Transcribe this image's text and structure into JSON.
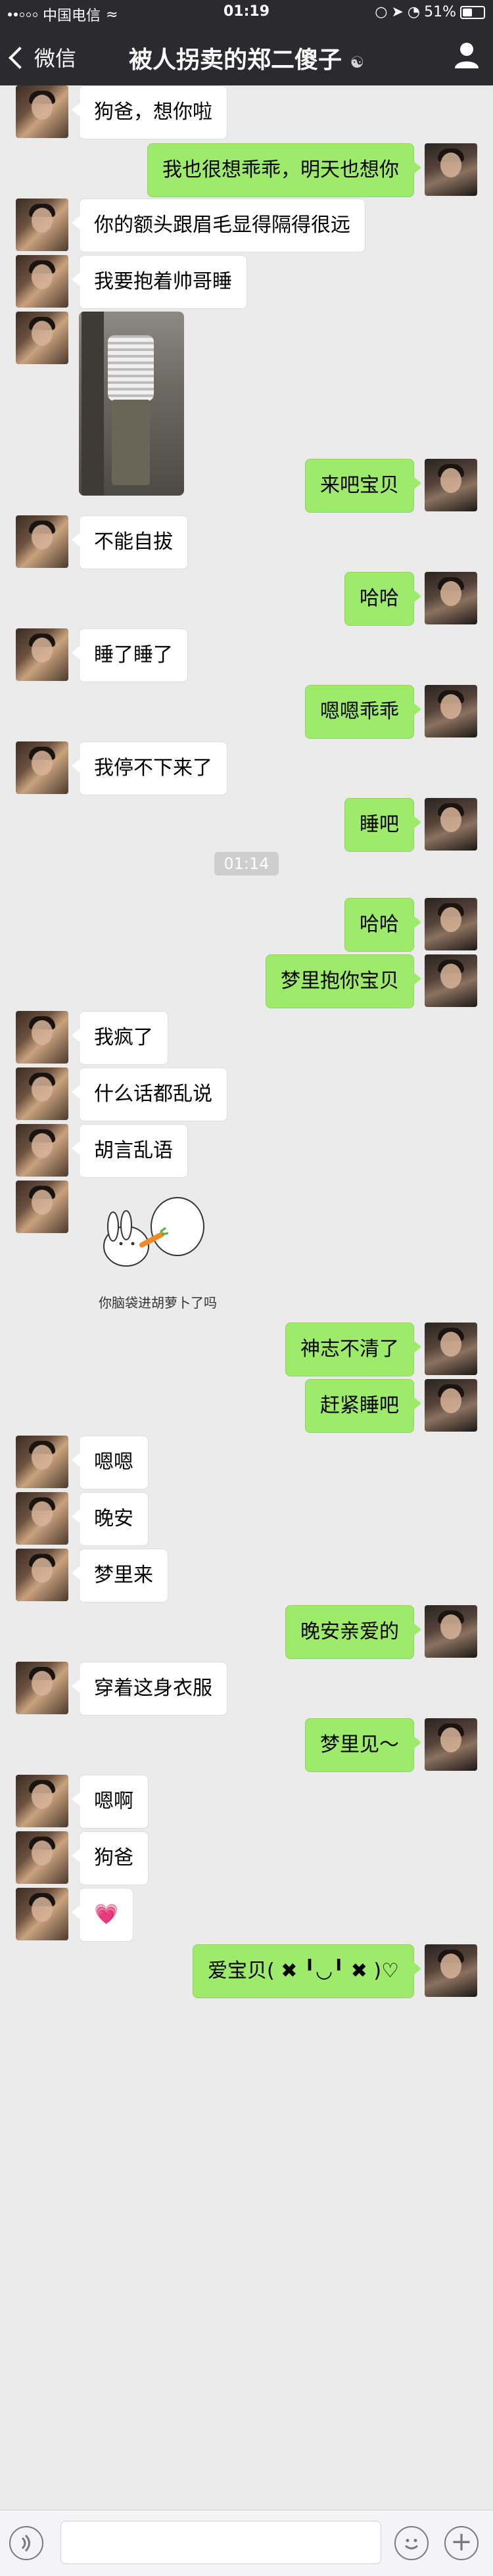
{
  "status_bar": {
    "carrier": "中国电信",
    "time": "01:19",
    "battery": "51%",
    "battery_level": 0.51
  },
  "nav": {
    "back_label": "微信",
    "title": "被人拐卖的郑二傻子"
  },
  "messages": [
    {
      "side": "in",
      "type": "text",
      "text": "狗爸，想你啦"
    },
    {
      "side": "out",
      "type": "text",
      "text": "我也很想乖乖，明天也想你"
    },
    {
      "side": "in",
      "type": "text",
      "text": "你的额头跟眉毛显得隔得很远"
    },
    {
      "side": "in",
      "type": "text",
      "text": "我要抱着帅哥睡"
    },
    {
      "side": "in",
      "type": "image"
    },
    {
      "side": "out",
      "type": "text",
      "text": "来吧宝贝"
    },
    {
      "side": "in",
      "type": "text",
      "text": "不能自拔"
    },
    {
      "side": "out",
      "type": "text",
      "text": "哈哈"
    },
    {
      "side": "in",
      "type": "text",
      "text": "睡了睡了"
    },
    {
      "side": "out",
      "type": "text",
      "text": "嗯嗯乖乖"
    },
    {
      "side": "in",
      "type": "text",
      "text": "我停不下来了"
    },
    {
      "side": "out",
      "type": "text",
      "text": "睡吧"
    },
    {
      "type": "time",
      "text": "01:14"
    },
    {
      "side": "out",
      "type": "text",
      "text": "哈哈"
    },
    {
      "side": "out",
      "type": "text",
      "text": "梦里抱你宝贝"
    },
    {
      "side": "in",
      "type": "text",
      "text": "我疯了"
    },
    {
      "side": "in",
      "type": "text",
      "text": "什么话都乱说"
    },
    {
      "side": "in",
      "type": "text",
      "text": "胡言乱语"
    },
    {
      "side": "in",
      "type": "sticker",
      "caption": "你脑袋进胡萝卜了吗"
    },
    {
      "side": "out",
      "type": "text",
      "text": "神志不清了"
    },
    {
      "side": "out",
      "type": "text",
      "text": "赶紧睡吧"
    },
    {
      "side": "in",
      "type": "text",
      "text": "嗯嗯"
    },
    {
      "side": "in",
      "type": "text",
      "text": "晚安"
    },
    {
      "side": "in",
      "type": "text",
      "text": "梦里来"
    },
    {
      "side": "out",
      "type": "text",
      "text": "晚安亲爱的"
    },
    {
      "side": "in",
      "type": "text",
      "text": "穿着这身衣服"
    },
    {
      "side": "out",
      "type": "text",
      "text": "梦里见～"
    },
    {
      "side": "in",
      "type": "text",
      "text": "嗯啊"
    },
    {
      "side": "in",
      "type": "text",
      "text": "狗爸"
    },
    {
      "side": "in",
      "type": "emoji",
      "text": "💗"
    },
    {
      "side": "out",
      "type": "text",
      "text": "爱宝贝( ✖ ╹◡╹ ✖ )♡"
    }
  ],
  "input": {
    "value": ""
  }
}
